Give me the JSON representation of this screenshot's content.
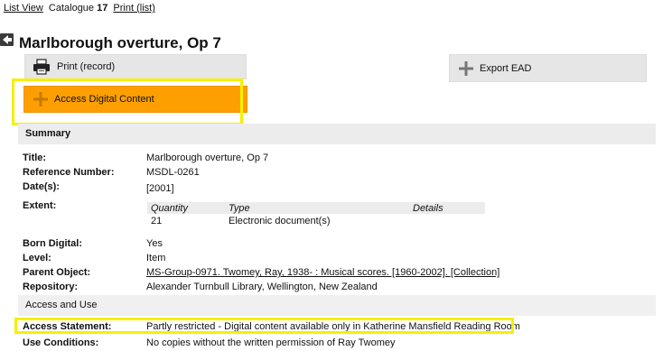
{
  "topnav": {
    "list_view": "List View",
    "catalogue_label": "Catalogue",
    "catalogue_number": "17",
    "print_list": "Print (list)"
  },
  "record": {
    "title": "Marlborough overture, Op 7"
  },
  "buttons": {
    "print": "Print (record)",
    "export": "Export EAD",
    "access": "Access Digital Content"
  },
  "colors": {
    "access_button": "#fd9f00",
    "highlight": "#f6ef00",
    "section_bar": "#ececec"
  },
  "summary": {
    "heading": "Summary",
    "fields": [
      {
        "label": "Title:",
        "value": "Marlborough overture, Op 7"
      },
      {
        "label": "Reference Number:",
        "value": "MSDL-0261"
      },
      {
        "label": "Date(s):",
        "value": "[2001]"
      },
      {
        "label": "Extent:",
        "value": ""
      },
      {
        "label": "Born Digital:",
        "value": "Yes"
      },
      {
        "label": "Level:",
        "value": "Item"
      },
      {
        "label": "Parent Object:",
        "value": "MS-Group-0971. Twomey, Ray, 1938- : Musical scores. [1960-2002]. [Collection]"
      },
      {
        "label": "Repository:",
        "value": "Alexander Turnbull Library, Wellington, New Zealand"
      }
    ],
    "extent": {
      "headers": [
        "Quantity",
        "Type",
        "Details"
      ],
      "row": [
        "21",
        "Electronic document(s)",
        ""
      ]
    }
  },
  "access": {
    "heading": "Access and Use",
    "statement_label": "Access Statement:",
    "statement_value": "Partly restricted - Digital content available only in Katherine Mansfield Reading Room",
    "conditions_label": "Use Conditions:",
    "conditions_value": "No copies without the written permission of Ray Twomey"
  }
}
